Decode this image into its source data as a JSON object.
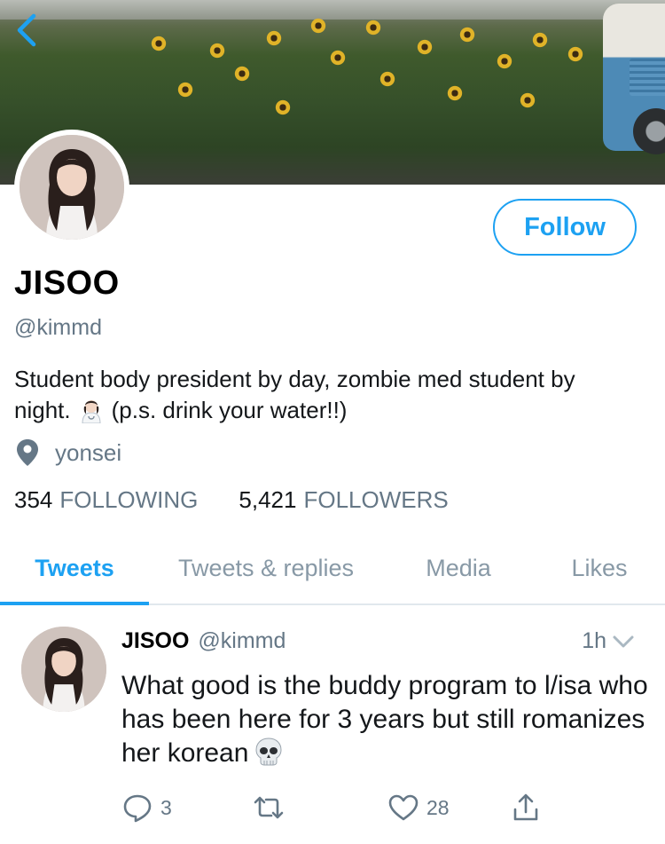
{
  "profile": {
    "name": "JISOO",
    "handle": "@kimmd",
    "bio_line1": "Student body president by day, zombie med student by",
    "bio_line2_start": "night.",
    "bio_line2_end": "(p.s. drink your water!!)",
    "location": "yonsei",
    "follow_label": "Follow"
  },
  "stats": {
    "following_count": "354",
    "following_label": "FOLLOWING",
    "followers_count": "5,421",
    "followers_label": "FOLLOWERS"
  },
  "tabs": [
    {
      "label": "Tweets",
      "active": true
    },
    {
      "label": "Tweets & replies",
      "active": false
    },
    {
      "label": "Media",
      "active": false
    },
    {
      "label": "Likes",
      "active": false
    }
  ],
  "tweet": {
    "name": "JISOO",
    "handle": "@kimmd",
    "time": "1h",
    "text": "What good is the buddy program to l/isa who has been here for 3 years but still romanizes her korean",
    "replies": "3",
    "retweets": "",
    "likes": "28"
  },
  "icons": {
    "back": "chevron-left-icon",
    "location": "location-pin-icon",
    "reply": "reply-icon",
    "retweet": "retweet-icon",
    "like": "heart-icon",
    "share": "share-icon"
  },
  "colors": {
    "accent": "#1da1f2",
    "secondary_text": "#657786",
    "primary_text": "#14171a"
  }
}
